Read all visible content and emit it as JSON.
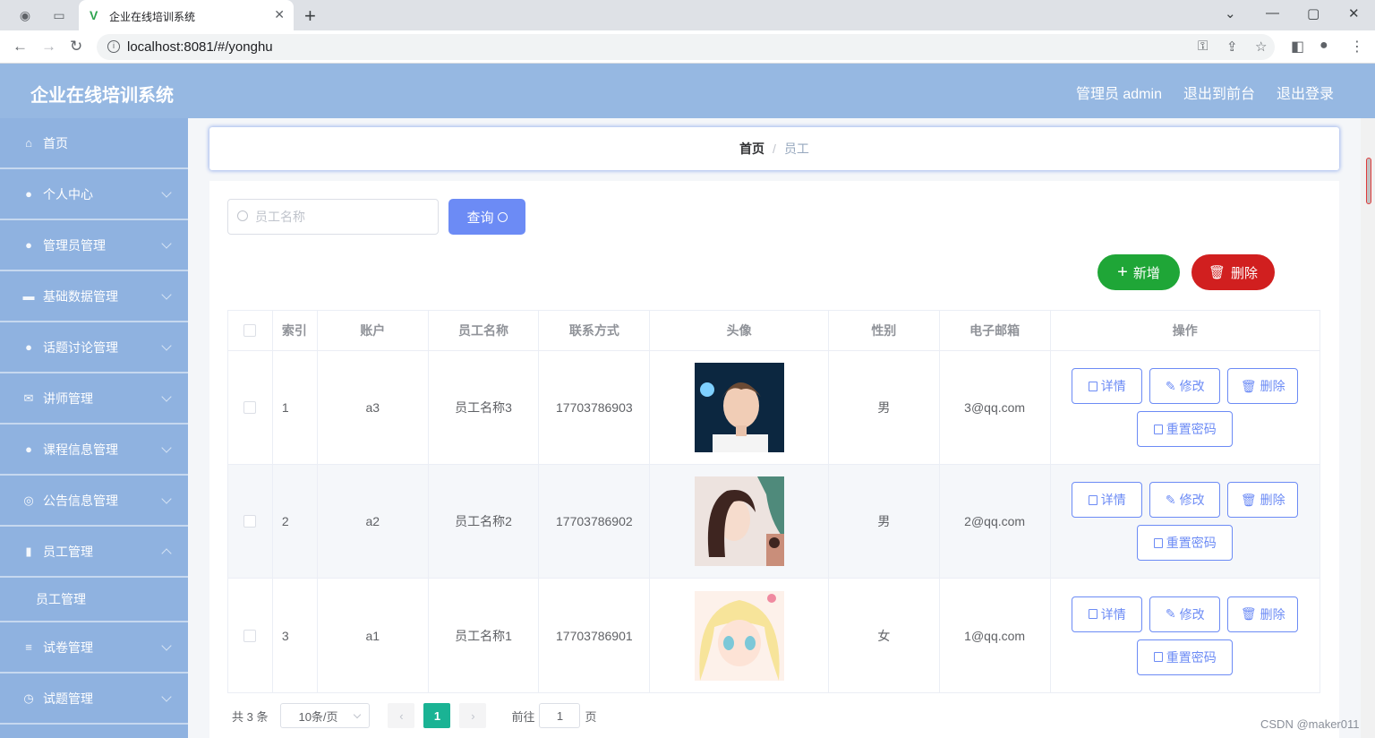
{
  "browser": {
    "tab_title": "企业在线培训系统",
    "url": "localhost:8081/#/yonghu"
  },
  "header": {
    "brand": "企业在线培训系统",
    "links": [
      "管理员 admin",
      "退出到前台",
      "退出登录"
    ]
  },
  "sidebar": {
    "items": [
      {
        "label": "首页",
        "icon": "home-icon",
        "expandable": false
      },
      {
        "label": "个人中心",
        "icon": "user-icon",
        "expandable": true
      },
      {
        "label": "管理员管理",
        "icon": "user-icon",
        "expandable": true
      },
      {
        "label": "基础数据管理",
        "icon": "folder-icon",
        "expandable": true
      },
      {
        "label": "话题讨论管理",
        "icon": "bulb-icon",
        "expandable": true
      },
      {
        "label": "讲师管理",
        "icon": "mail-icon",
        "expandable": true
      },
      {
        "label": "课程信息管理",
        "icon": "user-icon",
        "expandable": true
      },
      {
        "label": "公告信息管理",
        "icon": "compass-icon",
        "expandable": true
      },
      {
        "label": "员工管理",
        "icon": "chart-icon",
        "expandable": true,
        "open": true,
        "sub": "员工管理"
      },
      {
        "label": "试卷管理",
        "icon": "list-icon",
        "expandable": true
      },
      {
        "label": "试题管理",
        "icon": "clock-icon",
        "expandable": true
      }
    ]
  },
  "breadcrumb": {
    "home": "首页",
    "separator": "/",
    "current": "员工"
  },
  "search": {
    "placeholder": "员工名称",
    "button": "查询"
  },
  "actions": {
    "add": "新增",
    "delete": "删除"
  },
  "table": {
    "columns": [
      "索引",
      "账户",
      "员工名称",
      "联系方式",
      "头像",
      "性别",
      "电子邮箱",
      "操作"
    ],
    "rows": [
      {
        "index": "1",
        "account": "a3",
        "name": "员工名称3",
        "phone": "17703786903",
        "gender": "男",
        "email": "3@qq.com",
        "avatar": "boy-portrait"
      },
      {
        "index": "2",
        "account": "a2",
        "name": "员工名称2",
        "phone": "17703786902",
        "gender": "男",
        "email": "2@qq.com",
        "avatar": "girl-portrait"
      },
      {
        "index": "3",
        "account": "a1",
        "name": "员工名称1",
        "phone": "17703786901",
        "gender": "女",
        "email": "1@qq.com",
        "avatar": "anime-portrait"
      }
    ],
    "ops": {
      "detail": "详情",
      "edit": "修改",
      "delete": "删除",
      "reset": "重置密码"
    }
  },
  "pager": {
    "total": "共 3 条",
    "size": "10条/页",
    "current": "1",
    "goto_prefix": "前往",
    "goto_value": "1",
    "goto_suffix": "页"
  },
  "watermark": "CSDN @maker011",
  "colors": {
    "header": "#96b8e2",
    "sidebar": "#8fb2e0",
    "primary": "#6c8bf5",
    "success": "#1fa637",
    "danger": "#d11f1f",
    "pager_active": "#1ab394"
  }
}
